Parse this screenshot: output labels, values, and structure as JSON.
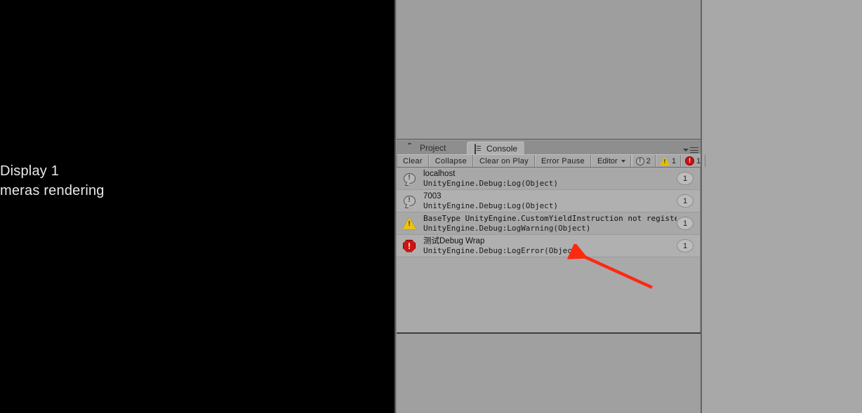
{
  "game_view": {
    "display_label": "Display 1",
    "no_cameras_label": "meras rendering"
  },
  "console_panel": {
    "tabs": [
      {
        "label": "Project",
        "icon": "folder-icon",
        "active": false
      },
      {
        "label": "Console",
        "icon": "document-icon",
        "active": true
      }
    ],
    "options_menu": "panel-options-icon",
    "toolbar": {
      "clear_label": "Clear",
      "collapse_label": "Collapse",
      "clear_on_play_label": "Clear on Play",
      "error_pause_label": "Error Pause",
      "editor_label": "Editor",
      "counts": {
        "info": "2",
        "warning": "1",
        "error": "1"
      }
    },
    "entries": [
      {
        "type": "info",
        "message": "localhost",
        "stack": "UnityEngine.Debug:Log(Object)",
        "count": "1"
      },
      {
        "type": "info",
        "message": "7003",
        "stack": "UnityEngine.Debug:Log(Object)",
        "count": "1"
      },
      {
        "type": "warning",
        "message": "BaseType UnityEngine.CustomYieldInstruction not register to lua",
        "stack": "UnityEngine.Debug:LogWarning(Object)",
        "count": "1"
      },
      {
        "type": "error",
        "message": "测试Debug Wrap",
        "stack": "UnityEngine.Debug:LogError(Object)",
        "count": "1"
      }
    ]
  },
  "annotation": {
    "arrow_color": "#fc2a10",
    "target": "error-log-entry"
  },
  "colors": {
    "game_background": "#000000",
    "editor_chrome": "#a0a0a0",
    "row_odd": "#a8a8a8",
    "row_even": "#b0b0b0",
    "error_red": "#cc1414",
    "warning_yellow": "#e6c21a"
  }
}
